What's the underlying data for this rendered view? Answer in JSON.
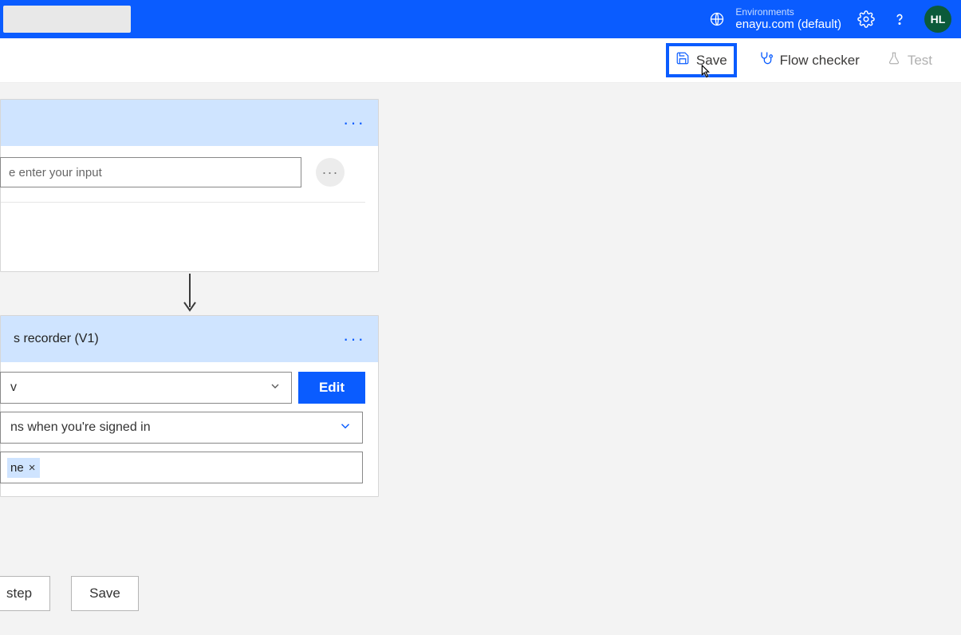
{
  "header": {
    "env_label": "Environments",
    "env_value": "enayu.com (default)",
    "avatar_initials": "HL"
  },
  "toolbar": {
    "save_label": "Save",
    "flow_checker_label": "Flow checker",
    "test_label": "Test"
  },
  "card1": {
    "input_placeholder": "e enter your input"
  },
  "card2": {
    "title": "s recorder (V1)",
    "select1_value": "v",
    "edit_label": "Edit",
    "select2_value": "ns when you're signed in",
    "token_text": "ne"
  },
  "bottom": {
    "step_label": "step",
    "save_label": "Save"
  }
}
